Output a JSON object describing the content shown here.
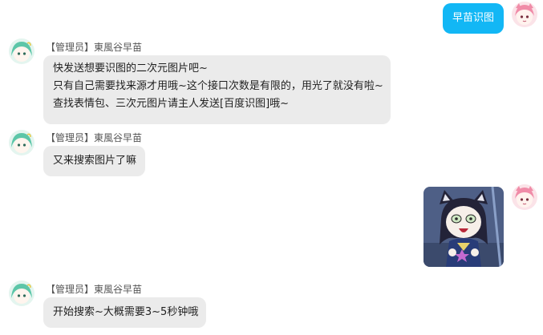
{
  "messages": [
    {
      "side": "right",
      "text": "早苗识图"
    },
    {
      "side": "left",
      "role_tag": "【管理员】",
      "sender_name": "東風谷早苗",
      "lines": [
        "快发送想要识图的二次元图片吧~",
        "只有自己需要找来源才用哦~这个接口次数是有限的，用光了就没有啦~",
        "查找表情包、三次元图片请主人发送[百度识图]哦~"
      ]
    },
    {
      "side": "left",
      "role_tag": "【管理员】",
      "sender_name": "東風谷早苗",
      "text": "又来搜索图片了嘛"
    },
    {
      "side": "right",
      "type": "image",
      "image_desc": "chibi-cat-ear-girl-sticker"
    },
    {
      "side": "left",
      "role_tag": "【管理员】",
      "sender_name": "東風谷早苗",
      "text": "开始搜索~大概需要3~5秒钟哦"
    }
  ],
  "colors": {
    "self_bubble": "#12b7f5",
    "other_bubble": "#ebebeb",
    "role_tag": "#555555"
  }
}
